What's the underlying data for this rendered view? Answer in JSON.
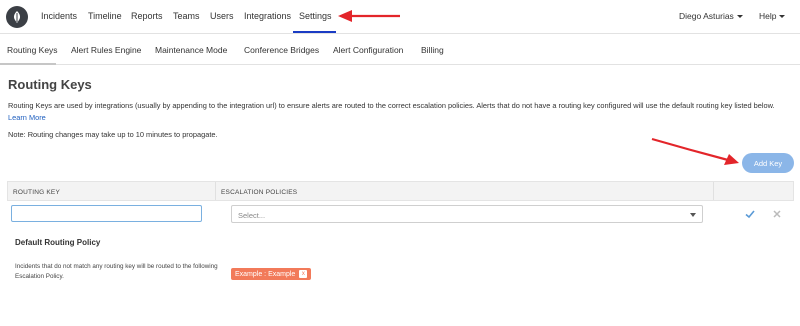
{
  "topnav": {
    "items": [
      "Incidents",
      "Timeline",
      "Reports",
      "Teams",
      "Users",
      "Integrations",
      "Settings"
    ],
    "active": "Settings",
    "user": "Diego Asturias",
    "help": "Help"
  },
  "subnav": {
    "items": [
      "Routing Keys",
      "Alert Rules Engine",
      "Maintenance Mode",
      "Conference Bridges",
      "Alert Configuration",
      "Billing"
    ],
    "active": "Routing Keys"
  },
  "page": {
    "title": "Routing Keys",
    "description": "Routing Keys are used by integrations (usually by appending to the integration url) to ensure alerts are routed to the correct escalation policies. Alerts that do not have a routing key configured will use the default routing key listed below.",
    "learn_more": "Learn More",
    "note": "Note: Routing changes may take up to 10 minutes to propagate.",
    "add_key": "Add Key"
  },
  "table": {
    "headers": [
      "ROUTING KEY",
      "ESCALATION POLICIES"
    ],
    "routing_key_value": "",
    "select_placeholder": "Select..."
  },
  "default_policy": {
    "title": "Default Routing Policy",
    "description": "Incidents that do not match any routing key will be routed to the following Escalation Policy.",
    "badge": "Example : Example",
    "badge_remove": "x"
  },
  "colors": {
    "accent": "#1a3cc4",
    "add_button": "#8bb6e8",
    "badge": "#f27a5a",
    "annotation_arrow": "#e3252a"
  }
}
